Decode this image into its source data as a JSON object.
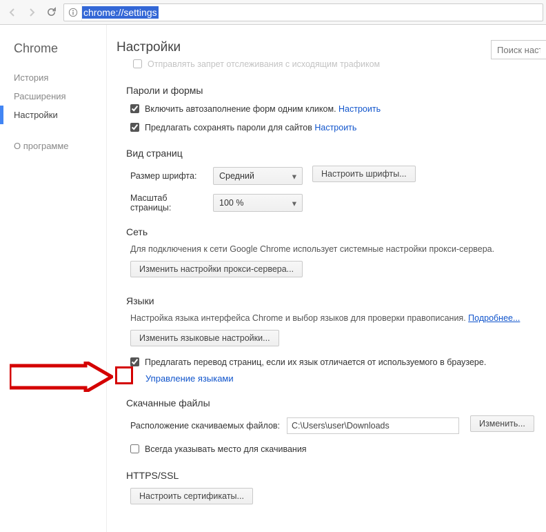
{
  "toolbar": {
    "url": "chrome://settings"
  },
  "sidebar": {
    "title": "Chrome",
    "items": [
      {
        "label": "История"
      },
      {
        "label": "Расширения"
      },
      {
        "label": "Настройки",
        "active": true
      },
      {
        "label": "О программе"
      }
    ]
  },
  "header": {
    "title": "Настройки",
    "search_placeholder": "Поиск настро"
  },
  "sections": {
    "tracking": {
      "row": "Отправлять запрет отслеживания с исходящим трафиком"
    },
    "passwords": {
      "title": "Пароли и формы",
      "row1": "Включить автозаполнение форм одним кликом.",
      "row2": "Предлагать сохранять пароли для сайтов",
      "link": "Настроить"
    },
    "appearance": {
      "title": "Вид страниц",
      "font_label": "Размер шрифта:",
      "font_value": "Средний",
      "font_btn": "Настроить шрифты...",
      "zoom_label": "Масштаб страницы:",
      "zoom_value": "100 %"
    },
    "network": {
      "title": "Сеть",
      "desc": "Для подключения к сети Google Chrome использует системные настройки прокси-сервера.",
      "btn": "Изменить настройки прокси-сервера..."
    },
    "languages": {
      "title": "Языки",
      "desc": "Настройка языка интерфейса Chrome и выбор языков для проверки правописания.",
      "more": "Подробнее...",
      "btn": "Изменить языковые настройки...",
      "check": "Предлагать перевод страниц, если их язык отличается от используемого в браузере.",
      "manage": "Управление языками"
    },
    "downloads": {
      "title": "Скачанные файлы",
      "label": "Расположение скачиваемых файлов:",
      "path": "C:\\Users\\user\\Downloads",
      "btn": "Изменить...",
      "check": "Всегда указывать место для скачивания"
    },
    "https": {
      "title": "HTTPS/SSL",
      "btn": "Настроить сертификаты..."
    }
  }
}
